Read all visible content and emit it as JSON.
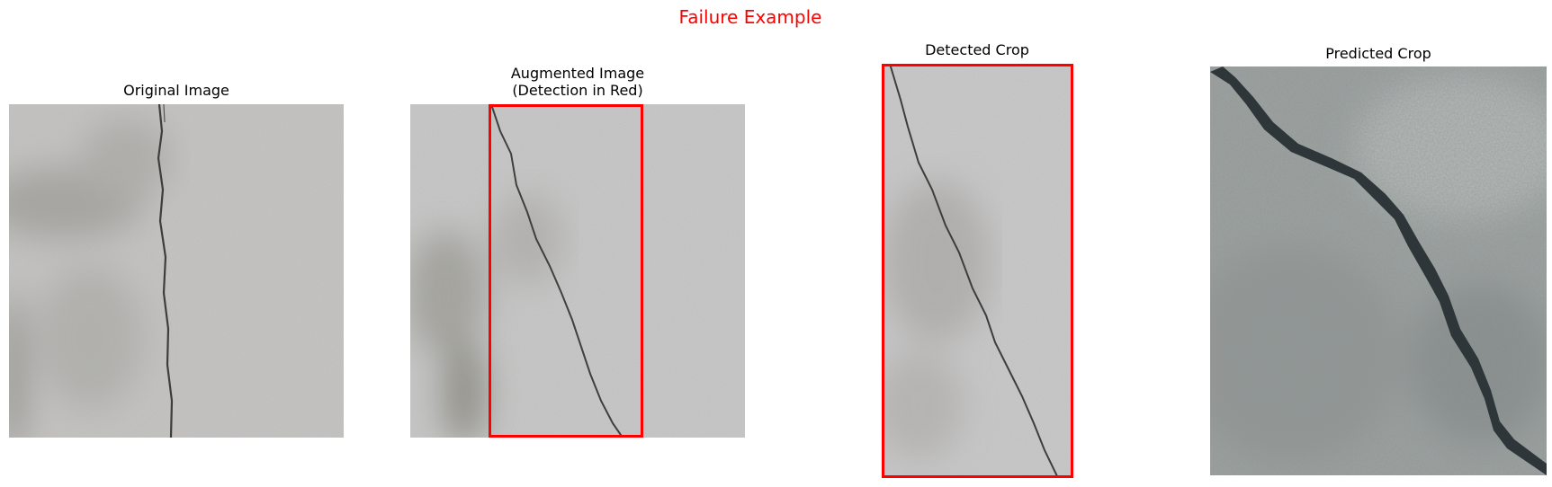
{
  "figure": {
    "title": "Failure Example",
    "title_color": "#ff0000",
    "detection_color": "#ff0000"
  },
  "panels": [
    {
      "title": "Original Image"
    },
    {
      "title": "Augmented Image\n(Detection in Red)"
    },
    {
      "title": "Detected Crop"
    },
    {
      "title": "Predicted Crop"
    }
  ]
}
